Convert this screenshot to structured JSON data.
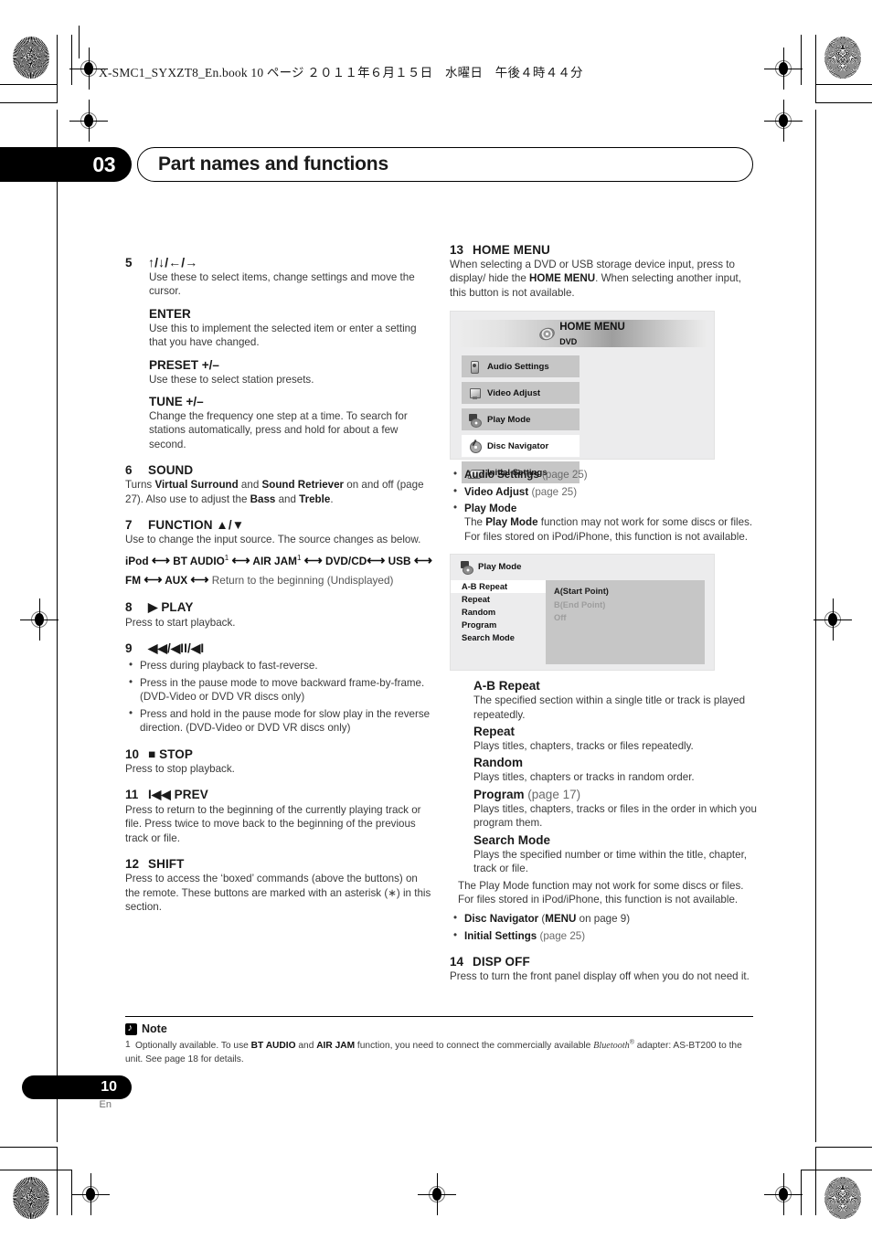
{
  "book_header": "X-SMC1_SYXZT8_En.book  10 ページ  ２０１１年６月１５日　水曜日　午後４時４４分",
  "chapter": {
    "number": "03",
    "title": "Part names and functions"
  },
  "left_column": {
    "item5": {
      "num": "5",
      "label": "↑/↓/←/→",
      "desc": "Use these to select items, change settings and move the cursor.",
      "enter_head": "ENTER",
      "enter_desc": "Use this to implement the selected item or enter a setting that you have changed.",
      "preset_head": "PRESET +/–",
      "preset_desc": "Use these to select station presets.",
      "tune_head": "TUNE +/–",
      "tune_desc": "Change the frequency one step at a time. To search for stations automatically, press and hold for about a few second."
    },
    "item6": {
      "num": "6",
      "label": "SOUND"
    },
    "item7": {
      "num": "7",
      "label": "FUNCTION ▲/▼",
      "desc": "Use to change the input source. The source changes as below.",
      "chain_tail": "Return to the beginning (Undisplayed)"
    },
    "item8": {
      "num": "8",
      "label": "▶ PLAY",
      "desc": "Press to start playback."
    },
    "item9": {
      "num": "9",
      "label": "◀◀/◀II/◀I",
      "bullets": [
        "Press during playback to fast-reverse.",
        "Press in the pause mode to move backward frame-by-frame. (DVD-Video or DVD VR discs only)",
        "Press and hold in the pause mode for slow play in the reverse direction. (DVD-Video or DVD VR discs only)"
      ]
    },
    "item10": {
      "num": "10",
      "label": "■ STOP",
      "desc": "Press to stop playback."
    },
    "item11": {
      "num": "11",
      "label": "I◀◀ PREV",
      "desc": "Press to return to the beginning of the currently playing track or file. Press twice to move back to the beginning of the previous track or file."
    },
    "item12": {
      "num": "12",
      "label": "SHIFT",
      "desc": "Press to access the ‘boxed’ commands (above the buttons) on the remote. These buttons are marked with an asterisk (∗) in this section."
    }
  },
  "right_column": {
    "item13": {
      "num": "13",
      "label": "HOME MENU"
    },
    "home_menu_figure": {
      "title": "HOME MENU",
      "subtitle": "DVD",
      "tiles": [
        {
          "label": "Audio Settings",
          "icon": "speaker-icon",
          "selected": false
        },
        {
          "label": "Video Adjust",
          "icon": "monitor-icon",
          "selected": false
        },
        {
          "label": "Play Mode",
          "icon": "play-mode-icon",
          "selected": false
        },
        {
          "label": "Disc Navigator",
          "icon": "disc-navigator-icon",
          "selected": true
        },
        {
          "label": "Initial Settings",
          "icon": "initial-settings-icon",
          "selected": false
        }
      ]
    },
    "play_mode_figure": {
      "title": "Play Mode",
      "list": [
        {
          "label": "A-B Repeat",
          "selected": true
        },
        {
          "label": "Repeat",
          "selected": false
        },
        {
          "label": "Random",
          "selected": false
        },
        {
          "label": "Program",
          "selected": false
        },
        {
          "label": "Search Mode",
          "selected": false
        }
      ],
      "options": [
        {
          "label": "A(Start Point)",
          "dim": false
        },
        {
          "label": "B(End Point)",
          "dim": true
        },
        {
          "label": "Off",
          "dim": true
        }
      ]
    },
    "playmode_defs": {
      "ab_head": "A-B Repeat",
      "ab_desc": "The specified section within a single title or track is played repeatedly.",
      "repeat_head": "Repeat",
      "repeat_desc": "Plays titles, chapters, tracks or files repeatedly.",
      "random_head": "Random",
      "random_desc": "Plays titles, chapters or tracks in random order.",
      "program_head": "Program",
      "program_page": "(page 17)",
      "program_desc": "Plays titles, chapters, tracks or files in the order in which you program them.",
      "search_head": "Search Mode",
      "search_desc": "Plays the specified number or time within the title, chapter, track or file.",
      "closing": "The Play Mode function may not work for some discs or files. For files stored in iPod/iPhone, this function is not available."
    },
    "item14": {
      "num": "14",
      "label": "DISP OFF",
      "desc": "Press to turn the front panel display off when you do not need it."
    }
  },
  "note": {
    "heading": "Note",
    "index": "1"
  },
  "footer": {
    "page": "10",
    "lang": "En"
  }
}
